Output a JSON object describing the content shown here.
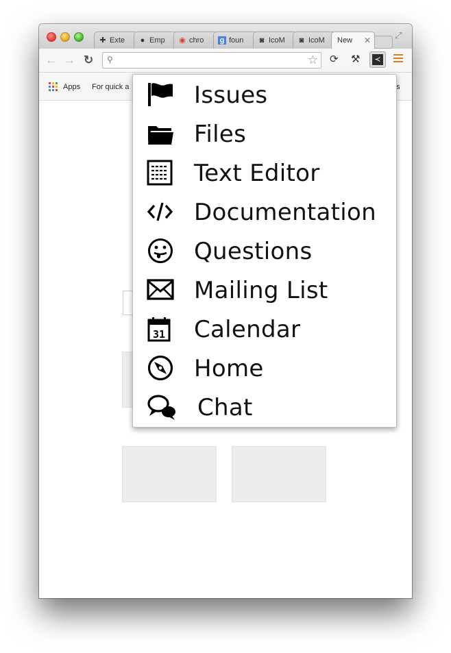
{
  "browser": {
    "tabs": [
      {
        "label": "Exte",
        "icon": "puzzle-icon",
        "active": false
      },
      {
        "label": "Emp",
        "icon": "github-icon",
        "active": false
      },
      {
        "label": "chro",
        "icon": "chrome-icon",
        "active": false
      },
      {
        "label": "foun",
        "icon": "google-icon",
        "active": false
      },
      {
        "label": "IcoM",
        "icon": "icomoon-icon",
        "active": false
      },
      {
        "label": "IcoM",
        "icon": "icomoon-icon",
        "active": false
      },
      {
        "label": "New",
        "icon": "",
        "active": true
      }
    ],
    "close_glyph": "✕",
    "address": {
      "value": "",
      "placeholder": ""
    },
    "nav": {
      "back": "←",
      "forward": "→",
      "reload": "C"
    }
  },
  "bookmarks": {
    "apps_label": "Apps",
    "quick_label": "For quick a",
    "right_label": "ts"
  },
  "menu": {
    "items": [
      {
        "label": "Issues",
        "icon": "flag-icon"
      },
      {
        "label": "Files",
        "icon": "folder-icon"
      },
      {
        "label": "Text Editor",
        "icon": "text-editor-icon"
      },
      {
        "label": "Documentation",
        "icon": "code-icon"
      },
      {
        "label": "Questions",
        "icon": "tongue-face-icon"
      },
      {
        "label": "Mailing List",
        "icon": "envelope-icon"
      },
      {
        "label": "Calendar",
        "icon": "calendar-icon"
      },
      {
        "label": "Home",
        "icon": "compass-icon"
      },
      {
        "label": "Chat",
        "icon": "chat-bubbles-icon"
      }
    ],
    "calendar_day": "31"
  },
  "colors": {
    "menu_accent": "#e07b1a",
    "tile_bg": "#ececec"
  }
}
